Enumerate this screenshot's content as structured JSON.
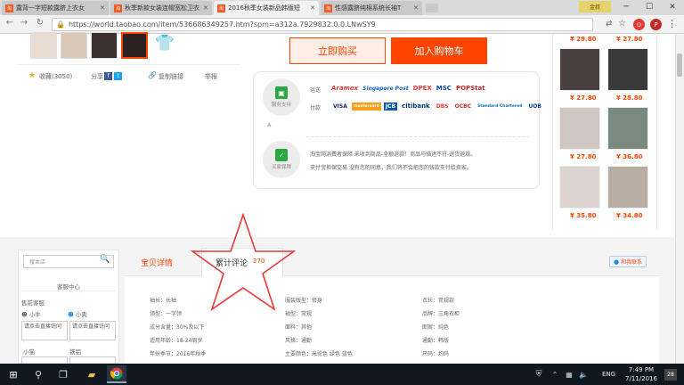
{
  "browser": {
    "tabs": [
      {
        "favicon": "淘",
        "title": "露背一字短款露脐上衣女",
        "active": false
      },
      {
        "favicon": "淘",
        "title": "秋季新款女装连帽宽松卫衣",
        "active": false
      },
      {
        "favicon": "淘",
        "title": "2016秋季女装新品韩版短",
        "active": true
      },
      {
        "favicon": "淘",
        "title": "性感露脐纯棉系统长袖T",
        "active": false
      }
    ],
    "user_button": "金叔",
    "url": "https://world.taobao.com/item/536686349257.htm?spm=a312a.7929832.0.0.LNwSY9"
  },
  "actions": {
    "favorite": "收藏(3050)",
    "share": "分享",
    "copy_link": "复制链接",
    "report": "举报"
  },
  "buttons": {
    "buy_now": "立即购买",
    "add_to_cart": "加入购物车"
  },
  "service": {
    "support_label": "服务支持",
    "buyer_label": "买家保障",
    "shipping_label": "运送",
    "payment_label": "付款",
    "shipping_logos": [
      "Aramex",
      "Singapore Post",
      "DPEX",
      "MSC",
      "POPStat"
    ],
    "payment_logos": [
      "VISA",
      "mastercard",
      "JCB",
      "citibank",
      "DBS",
      "OCBC",
      "Standard Chartered",
      "UOB"
    ],
    "guarantee_line1": "淘宝网消费者保障    未收到商品-全额退款！商品与描述不符-退货退款。",
    "guarantee_line2": "支付宝担保交易    没有您的同意，我们将不会把您的钱款支付给卖家。"
  },
  "right_products": {
    "prices": [
      "¥ 29.80",
      "¥ 27.80",
      "¥ 27.80",
      "¥ 28.80",
      "¥ 27.80",
      "¥ 36.80",
      "¥ 35.80",
      "¥ 34.80"
    ]
  },
  "sidebar": {
    "search_placeholder": "搜本店",
    "service_center": "客服中心",
    "presale_title": "售前客服",
    "agents": [
      "小牛",
      "小肉"
    ],
    "contact_text": "请点击直接访问",
    "agents2": [
      "小猫",
      "铁铝"
    ]
  },
  "detail_tabs": {
    "details": "宝贝详情",
    "reviews": "累计评论",
    "review_count": "270",
    "contact": "和我联系"
  },
  "attributes": [
    [
      "袖长：长袖",
      "服装版型：修身",
      "衣长：常规款"
    ],
    [
      "领型：一字领",
      "袖型：常规",
      "品牌：三角衣柜"
    ],
    [
      "成分含量：30%及以下",
      "面料：其他",
      "图案：纯色"
    ],
    [
      "适用年龄：18-24周岁",
      "风格：通勤",
      "通勤：韩版"
    ],
    [
      "年份季节：2016年秋季",
      "主要颜色：米驼色 绿色 蓝色",
      "尺码：均码"
    ]
  ],
  "taskbar": {
    "language": "ENG",
    "time": "7:49 PM",
    "date": "7/11/2016",
    "notification_count": "28"
  },
  "colors": {
    "accent": "#ff4400",
    "buy_bg": "#ffeee6",
    "tab_active": "#f2f2f2",
    "star": "#e53935"
  }
}
